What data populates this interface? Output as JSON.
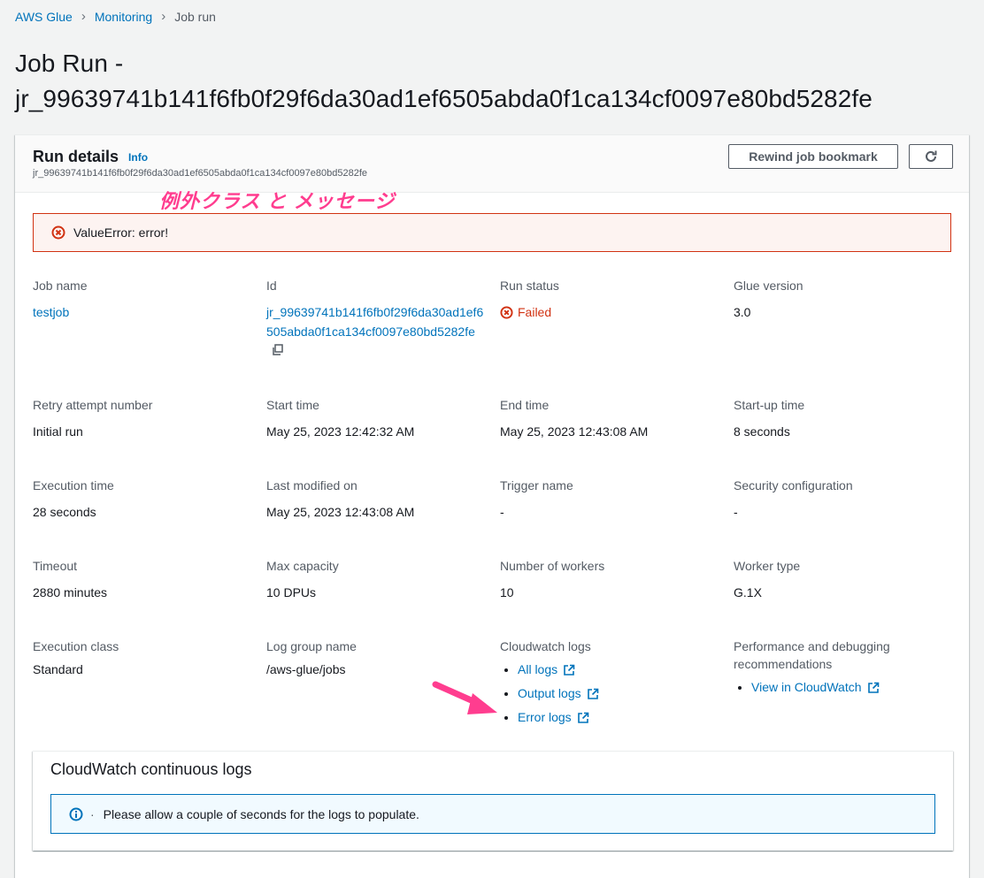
{
  "breadcrumb": [
    "AWS Glue",
    "Monitoring",
    "Job run"
  ],
  "page": {
    "title_line1": "Job Run -",
    "title_line2": "jr_99639741b141f6fb0f29f6da30ad1ef6505abda0f1ca134cf0097e80bd5282fe"
  },
  "panel": {
    "title": "Run details",
    "info_label": "Info",
    "subtitle": "jr_99639741b141f6fb0f29f6da30ad1ef6505abda0f1ca134cf0097e80bd5282fe",
    "rewind_button": "Rewind job bookmark",
    "refresh_icon": "refresh-icon"
  },
  "annotation": {
    "text": "例外クラス と メッセージ",
    "color": "#ff3d8f"
  },
  "error": {
    "message": "ValueError: error!",
    "icon": "error-circle-icon",
    "color": "#d13212"
  },
  "details": {
    "job_name": {
      "label": "Job name",
      "value": "testjob"
    },
    "id": {
      "label": "Id",
      "value": "jr_99639741b141f6fb0f29f6da30ad1ef6505abda0f1ca134cf0097e80bd5282fe"
    },
    "run_status": {
      "label": "Run status",
      "value": "Failed"
    },
    "glue_version": {
      "label": "Glue version",
      "value": "3.0"
    },
    "retry_attempt": {
      "label": "Retry attempt number",
      "value": "Initial run"
    },
    "start_time": {
      "label": "Start time",
      "value": "May 25, 2023 12:42:32 AM"
    },
    "end_time": {
      "label": "End time",
      "value": "May 25, 2023 12:43:08 AM"
    },
    "startup_time": {
      "label": "Start-up time",
      "value": "8 seconds"
    },
    "execution_time": {
      "label": "Execution time",
      "value": "28 seconds"
    },
    "last_modified": {
      "label": "Last modified on",
      "value": "May 25, 2023 12:43:08 AM"
    },
    "trigger_name": {
      "label": "Trigger name",
      "value": "-"
    },
    "security_config": {
      "label": "Security configuration",
      "value": "-"
    },
    "timeout": {
      "label": "Timeout",
      "value": "2880 minutes"
    },
    "max_capacity": {
      "label": "Max capacity",
      "value": "10 DPUs"
    },
    "num_workers": {
      "label": "Number of workers",
      "value": "10"
    },
    "worker_type": {
      "label": "Worker type",
      "value": "G.1X"
    },
    "execution_class": {
      "label": "Execution class",
      "value": "Standard"
    },
    "log_group": {
      "label": "Log group name",
      "value": "/aws-glue/jobs"
    },
    "cloudwatch_logs": {
      "label": "Cloudwatch logs",
      "links": [
        "All logs",
        "Output logs",
        "Error logs"
      ]
    },
    "performance": {
      "label": "Performance and debugging recommendations",
      "links": [
        "View in CloudWatch"
      ]
    }
  },
  "cloudwatch": {
    "title": "CloudWatch continuous logs",
    "info_message": "Please allow a couple of seconds for the logs to populate.",
    "info_dot": "·"
  },
  "colors": {
    "link": "#0073bb",
    "background": "#f2f3f3",
    "arrow": "#ff3d8f"
  }
}
